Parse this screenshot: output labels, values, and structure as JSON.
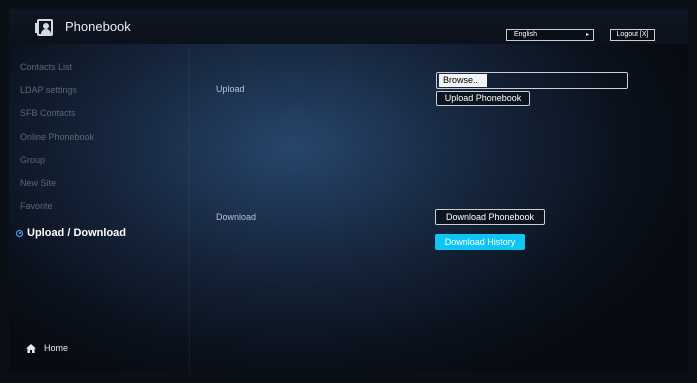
{
  "header": {
    "app_title": "Phonebook",
    "language": "English",
    "logout_label": "Logout [X]"
  },
  "sidebar": {
    "items": [
      {
        "label": "Contacts List"
      },
      {
        "label": "LDAP settings"
      },
      {
        "label": "SFB Contacts"
      },
      {
        "label": "Online Phonebook"
      },
      {
        "label": "Group"
      },
      {
        "label": "New Site"
      },
      {
        "label": "Favorite"
      },
      {
        "label": "Upload / Download",
        "active": true
      }
    ],
    "home_label": "Home"
  },
  "main": {
    "upload": {
      "label": "Upload",
      "browse_label": "Browse..",
      "upload_button": "Upload Phonebook"
    },
    "download": {
      "label": "Download",
      "download_button": "Download Phonebook",
      "history_button": "Download History"
    }
  },
  "colors": {
    "accent": "#0fc5f3",
    "active_marker": "#5ab0ff"
  }
}
